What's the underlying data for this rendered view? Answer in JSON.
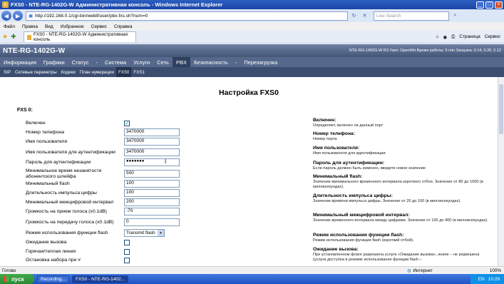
{
  "window": {
    "title": "FXS0 - NTE-RG-1402G-W Административная консоль - Windows Internet Explorer",
    "min": "_",
    "max": "□",
    "close": "×"
  },
  "addressbar": {
    "url": "http://192.168.0.1/cgi-bin/webif/user/pbx-fxs.sh?num=0",
    "search_placeholder": "Live Search"
  },
  "menu": [
    "Файл",
    "Правка",
    "Вид",
    "Избранное",
    "Сервис",
    "Справка"
  ],
  "tab": {
    "label": "FXS0 - NTE-RG-1402G-W Административная консоль"
  },
  "commands": {
    "page": "Страница",
    "tools": "Сервис"
  },
  "router": {
    "logo": "NTE-RG-1402G-W",
    "status": "NTE-RG-1402G-W R3 Узел: OpenWrt Время работы: 5 min Загрузка: 0.14, 0.26, 0.12",
    "main_nav": [
      "Информация",
      "Графики",
      "Статус",
      "-",
      "Система",
      "Услуги",
      "Сеть",
      "PBX",
      "Безопасность",
      "-",
      "Перезагрузка"
    ],
    "main_active": "PBX",
    "sub_nav": [
      "SIP",
      "Сетевые параметры",
      "Кодеки",
      "План нумерации",
      "FXS0",
      "FXS1"
    ],
    "sub_active": "FXS0"
  },
  "page": {
    "title": "Настройка FXS0",
    "section": "FXS 0:",
    "fields": [
      {
        "label": "Включен",
        "type": "checkbox",
        "checked": true
      },
      {
        "label": "Номер телефона",
        "type": "text",
        "value": "3470000"
      },
      {
        "label": "Имя пользователя",
        "type": "text",
        "value": "3470000"
      },
      {
        "label": "Имя пользователя для аутентификации",
        "type": "text",
        "value": "3470000"
      },
      {
        "label": "Пароль для аутентификации",
        "type": "password",
        "value": "●●●●●●●"
      },
      {
        "label": "Минимальное время незанятости абонентского шлейфа",
        "type": "text",
        "value": "500"
      },
      {
        "label": "Минимальный flash",
        "type": "text",
        "value": "100"
      },
      {
        "label": "Длительность импульса цифры",
        "type": "text",
        "value": "100"
      },
      {
        "label": "Минимальный межцифровой интервал",
        "type": "text",
        "value": "200"
      },
      {
        "label": "Громкость на прием голоса (x0.1dB)",
        "type": "text",
        "value": "-70"
      },
      {
        "label": "Громкость на передачу голоса (x0.1dB)",
        "type": "text",
        "value": "0"
      },
      {
        "label": "Режим использования функции flash",
        "type": "select",
        "value": "Transmit flash"
      },
      {
        "label": "Ожидание вызова",
        "type": "checkbox",
        "checked": false
      },
      {
        "label": "Горячая/теплая линия",
        "type": "checkbox",
        "checked": false
      },
      {
        "label": "Остановка набора при #",
        "type": "checkbox",
        "checked": false
      }
    ],
    "help": [
      {
        "title": "Включен:",
        "desc": "Определяет, включен ли данный порт"
      },
      {
        "title": "Номер телефона:",
        "desc": "Номер порта"
      },
      {
        "title": "Имя пользователя:",
        "desc": "Имя пользователя для идентификации"
      },
      {
        "title": "Пароль для аутентификации:",
        "desc": "Если пароль должен быть изменен, введите новое значение"
      },
      {
        "title": "Минимальный flash:",
        "desc": "Значение минимального временного интервала короткого отбоя. Значение от 80 до 1000 (в миллисекундах)."
      },
      {
        "title": "Длительность импульса цифры:",
        "desc": "Значение времени импульса цифры. Значение от 20 до 100 (в миллисекундах)."
      },
      {
        "title": "Минимальный межцифровой интервал:",
        "desc": "Значение временного интервала между цифрами. Значение от 100 до 400 (в миллисекундах)."
      },
      {
        "title": "Режим использования функции flash:",
        "desc": "Режим использования функции flash (короткий отбой)."
      },
      {
        "title": "Ожидание вызова:",
        "desc": "При установленном флаге разрешена услуга «Ожидание вызова», иначе – не разрешена (услуга доступна в режиме использования функции flash –"
      }
    ]
  },
  "statusbar": {
    "left": "Готово",
    "zone": "Интернет",
    "zoom": "100%"
  },
  "taskbar": {
    "start": "пуск",
    "tasks": [
      "Recording...",
      "FXS0 - NTE-RG-1402..."
    ],
    "lang": "EN",
    "clock": "10:29"
  }
}
